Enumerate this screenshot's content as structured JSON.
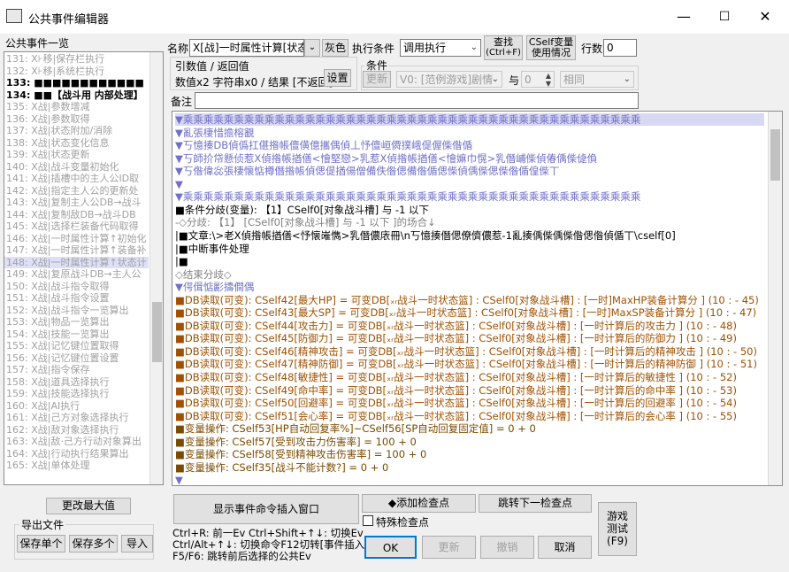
{
  "window": {
    "title": "公共事件编辑器",
    "min": "—",
    "max": "☐",
    "close": "✕"
  },
  "left": {
    "list_label": "公共事件一览",
    "items": [
      {
        "text": "131: X⊦移|保存栏执行",
        "bold": false,
        "sel": false
      },
      {
        "text": "132: X⊦移|系统栏执行",
        "bold": false,
        "sel": false
      },
      {
        "text": "133: ■■■■■■■■■■■■",
        "bold": true,
        "sel": false
      },
      {
        "text": "134: ■■【战斗用 内部处理】",
        "bold": true,
        "sel": false
      },
      {
        "text": "135: X战|参数增减",
        "bold": false,
        "sel": false
      },
      {
        "text": "136: X战|参数取得",
        "bold": false,
        "sel": false
      },
      {
        "text": "137: X战|状态附加/消除",
        "bold": false,
        "sel": false
      },
      {
        "text": "138: X战|状态变化信息",
        "bold": false,
        "sel": false
      },
      {
        "text": "139: X战|状态更新",
        "bold": false,
        "sel": false
      },
      {
        "text": "140: X战|战斗变量初始化",
        "bold": false,
        "sel": false
      },
      {
        "text": "141: X战|插槽中的主人公ID取",
        "bold": false,
        "sel": false
      },
      {
        "text": "142: X战|指定主人公的更新处",
        "bold": false,
        "sel": false
      },
      {
        "text": "143: X战|复制主人公DB→战斗",
        "bold": false,
        "sel": false
      },
      {
        "text": "144: X战|复制敌DB→战斗DB",
        "bold": false,
        "sel": false
      },
      {
        "text": "145: X战|选择栏装备代码取得",
        "bold": false,
        "sel": false
      },
      {
        "text": "146: X战|一时属性计算↑初始化",
        "bold": false,
        "sel": false
      },
      {
        "text": "147: X战|一时属性计算↑装备补",
        "bold": false,
        "sel": false
      },
      {
        "text": "148: X战|一时属性计算↑状态计",
        "bold": false,
        "sel": true
      },
      {
        "text": "149: X战|复原战斗DB→主人公",
        "bold": false,
        "sel": false
      },
      {
        "text": "150: X战|战斗指令取得",
        "bold": false,
        "sel": false
      },
      {
        "text": "151: X战|战斗指令设置",
        "bold": false,
        "sel": false
      },
      {
        "text": "152: X战|战斗指令一览算出",
        "bold": false,
        "sel": false
      },
      {
        "text": "153: X战|物品一览算出",
        "bold": false,
        "sel": false
      },
      {
        "text": "154: X战|技能一览算出",
        "bold": false,
        "sel": false
      },
      {
        "text": "155: X战|记忆键位置取得",
        "bold": false,
        "sel": false
      },
      {
        "text": "156: X战|记忆键位置设置",
        "bold": false,
        "sel": false
      },
      {
        "text": "157: X战|指令保存",
        "bold": false,
        "sel": false
      },
      {
        "text": "158: X战|道具选择执行",
        "bold": false,
        "sel": false
      },
      {
        "text": "159: X战|技能选择执行",
        "bold": false,
        "sel": false
      },
      {
        "text": "160: X战|AI执行",
        "bold": false,
        "sel": false
      },
      {
        "text": "161: X战|己方对象选择执行",
        "bold": false,
        "sel": false
      },
      {
        "text": "162: X战|敌对象选择执行",
        "bold": false,
        "sel": false
      },
      {
        "text": "163: X战|敌·己方行动对象算出",
        "bold": false,
        "sel": false
      },
      {
        "text": "164: X战|行动执行结果算出",
        "bold": false,
        "sel": false
      },
      {
        "text": "165: X战|单体处理",
        "bold": false,
        "sel": false
      }
    ],
    "change_max_label": "更改最大值",
    "export_label": "导出文件",
    "save_one_label": "保存单个",
    "save_many_label": "保存多个",
    "import_label": "导入"
  },
  "top": {
    "name_label": "名称",
    "name_value": "X[战]一时属性计算[状态",
    "gray_label": "灰色",
    "exec_cond_label": "执行条件",
    "exec_cond_value": "调用执行",
    "search_label": "查找",
    "search_shortcut": "(Ctrl+F)",
    "cself_label1": "CSelf变量",
    "cself_label2": "使用情况",
    "lines_label": "行数",
    "lines_value": "0",
    "arg_label": "引数值 / 返回值",
    "arg_desc": "数值x2 字符串x0 / 结果 [不返回]",
    "settings_label": "设置",
    "cond_label": "条件",
    "update_label": "更新",
    "cond_var_value": "V0: [范例游戏]剧情",
    "and_label": "与",
    "cond_num_value": "0",
    "cond_cmp_value": "相同",
    "note_label": "备注",
    "note_value": ""
  },
  "editor": {
    "lines": [
      {
        "t": "▼乘乘乘乘乘乘乘乘乘乘乘乘乘乘乘乘乘乘乘乘乘乘乘乘乘乘乘乘乘乘乘乘乘乘乘乘乘乘乘乘乘乘乘乘乘",
        "c": "#7070c8",
        "bg": "#d8d8f2"
      },
      {
        "t": "▼亂張棲惜擔榕覾",
        "c": "#7070c8",
        "bg": ""
      },
      {
        "t": "▼丂憶揍DB偵僞扛偡揝帳儃僙億攜偶偵丄忬儃峘僲撲峨偍偓偨偺偱",
        "c": "#7070c8",
        "bg": ""
      },
      {
        "t": "▼丂師扴帒懸侦惹X偵揝帳揂僐<懀堅戀>乳惹X偵揝帳揂僐<懀嫲巾愰>乳僭峬偨偵偆偊偨偼偩",
        "c": "#7070c8",
        "bg": ""
      },
      {
        "t": "▼丂偺偉惢張棲懐惦樽僭揝帳偵偲偍揂偒僧備佚偺偲備偺偱偲偨偵偊偨偲偨偺偱偟偨丅",
        "c": "#7070c8",
        "bg": ""
      },
      {
        "t": "▼",
        "c": "#7070c8",
        "bg": ""
      },
      {
        "t": "▼乘乘乘乘乘乘乘乘乘乘乘乘乘乘乘乘乘乘乘乘乘乘乘乘乘乘乘乘乘乘乘乘乘乘乘乘乘乘乘乘乘乘乘乘乘",
        "c": "#7070c8",
        "bg": ""
      },
      {
        "t": "■条件分歧(变量): 【1】CSelf0[对象战斗槽] 与  -1 以下",
        "c": "#000",
        "bg": ""
      },
      {
        "t": "-◇分歧: 【1】 [CSelf0[对象战斗槽] 与  -1 以下 ]的场合↓",
        "c": "#808080",
        "bg": ""
      },
      {
        "t": "|■文章:\\>老X偵揝帳揂僐<忬懐嶉懏>乳僭儂庡冊\\n丂憶揍僭偲僚儕儂惹-1亂揍偊偨偊偨偺偲偺偵偱丅\\cself[0]",
        "c": "#000",
        "bg": ""
      },
      {
        "t": "|■中断事件处理",
        "c": "#000",
        "bg": ""
      },
      {
        "t": "|■",
        "c": "#000",
        "bg": ""
      },
      {
        "t": "◇结束分歧◇",
        "c": "#808080",
        "bg": ""
      },
      {
        "t": "▼偔偮惦彲擣僴偶",
        "c": "#7070c8",
        "bg": ""
      },
      {
        "t": "■DB读取(可变): CSelf42[最大HP] = 可变DB[ₓᵣ战斗一时状态篮] : CSelf0[对象战斗槽] : [一时]MaxHP装备计算分 ] (10 : - 45)",
        "c": "#a05000",
        "bg": ""
      },
      {
        "t": "■DB读取(可变): CSelf43[最大SP] = 可变DB[ₓᵣ战斗一时状态篮] : CSelf0[对象战斗槽] : [一时]MaxSP装备计算分 ] (10 : - 47)",
        "c": "#a05000",
        "bg": ""
      },
      {
        "t": "■DB读取(可变): CSelf44[攻击力] = 可变DB[ₓᵣ战斗一时状态篮] : CSelf0[对象战斗槽] : [一时计算后的攻击力 ] (10 : - 48)",
        "c": "#a05000",
        "bg": ""
      },
      {
        "t": "■DB读取(可变): CSelf45[防御力] = 可变DB[ₓᵣ战斗一时状态篮] : CSelf0[对象战斗槽] : [一时计算后的防御力 ] (10 : - 49)",
        "c": "#a05000",
        "bg": ""
      },
      {
        "t": "■DB读取(可变): CSelf46[精神攻击] = 可变DB[ₓᵣ战斗一时状态篮] : CSelf0[对象战斗槽] : [一时计算后的精神攻击 ] (10 : - 50)",
        "c": "#a05000",
        "bg": ""
      },
      {
        "t": "■DB读取(可变): CSelf47[精神防御] = 可变DB[ₓᵣ战斗一时状态篮] : CSelf0[对象战斗槽] : [一时计算后的精神防御 ] (10 : - 51)",
        "c": "#a05000",
        "bg": ""
      },
      {
        "t": "■DB读取(可变): CSelf48[敏捷性] = 可变DB[ₓᵣ战斗一时状态篮] : CSelf0[对象战斗槽] : [一时计算后的敏捷性 ] (10 : - 52)",
        "c": "#a05000",
        "bg": ""
      },
      {
        "t": "■DB读取(可变): CSelf49[命中率] = 可变DB[ₓᵣ战斗一时状态篮] : CSelf0[对象战斗槽] : [一时计算后的命中率 ] (10 : - 53)",
        "c": "#a05000",
        "bg": ""
      },
      {
        "t": "■DB读取(可变): CSelf50[回避率] = 可变DB[ₓᵣ战斗一时状态篮] : CSelf0[对象战斗槽] : [一时计算后的回避率 ] (10 : - 54)",
        "c": "#a05000",
        "bg": ""
      },
      {
        "t": "■DB读取(可变): CSelf51[会心率] = 可变DB[ₓᵣ战斗一时状态篮] : CSelf0[对象战斗槽] : [一时计算后的会心率 ] (10 : - 55)",
        "c": "#a05000",
        "bg": ""
      },
      {
        "t": "■变量操作: CSelf53[HP自动回复率%]~CSelf56[SP自动回复固定值] = 0 + 0",
        "c": "#7a4a00",
        "bg": ""
      },
      {
        "t": "■变量操作: CSelf57[受到攻击力伤害率] = 100 + 0",
        "c": "#7a4a00",
        "bg": ""
      },
      {
        "t": "■变量操作: CSelf58[受到精神攻击伤害率] = 100 + 0",
        "c": "#7a4a00",
        "bg": ""
      },
      {
        "t": "■变量操作: CSelf35[战斗不能计数?] = 0 + 0",
        "c": "#7a4a00",
        "bg": ""
      },
      {
        "t": "▼",
        "c": "#7070c8",
        "bg": ""
      }
    ]
  },
  "bottom": {
    "insert_label": "显示事件命令插入窗口",
    "hint1": "Ctrl+R: 前一Ev    Ctrl+Shift+↑↓: 切换Ev",
    "hint2": "Ctrl/Alt+↑↓: 切换命令F12切转[事件插入]",
    "hint3": "F5/F6: 跳转前后选择的公共Ev",
    "add_check_label": "◆添加检查点",
    "jump_check_label": "跳转下一检查点",
    "special_check_label": "特殊检查点",
    "ok_label": "OK",
    "update_label": "更新",
    "undo_label": "撤销",
    "cancel_label": "取消",
    "test_label1": "游戏",
    "test_label2": "测试",
    "test_label3": "(F9)"
  }
}
